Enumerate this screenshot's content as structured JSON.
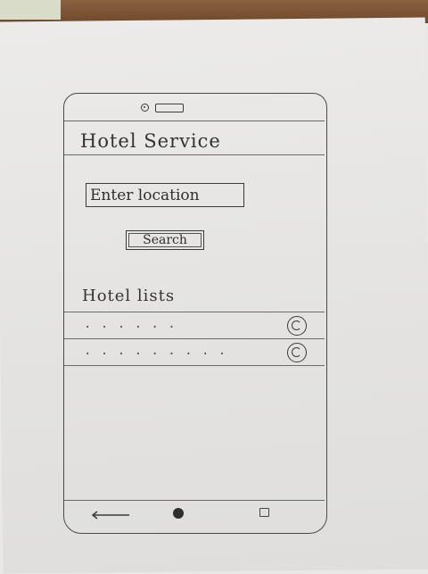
{
  "app": {
    "title": "Hotel Service"
  },
  "search": {
    "placeholder": "Enter location",
    "button_label": "Search"
  },
  "hotels": {
    "heading": "Hotel lists",
    "items": [
      {
        "text": ". . . . . ."
      },
      {
        "text": ". . . . . . . . ."
      }
    ]
  },
  "nav": {
    "back_icon": "back-arrow-icon",
    "home_icon": "home-icon",
    "recent_icon": "recent-apps-icon"
  }
}
